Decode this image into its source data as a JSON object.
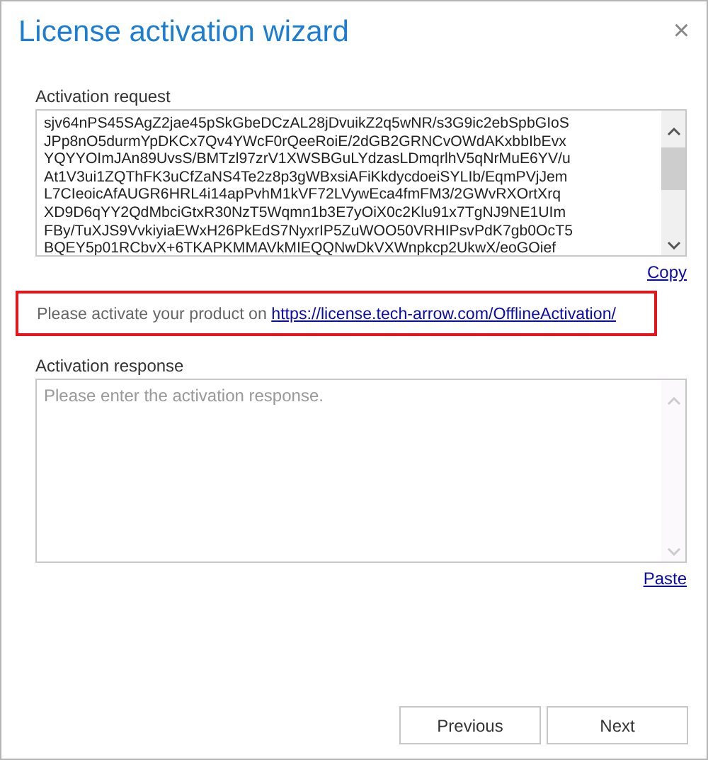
{
  "window": {
    "title": "License activation wizard",
    "close": "×"
  },
  "activation_request": {
    "label": "Activation request",
    "value": "sjv64nPS45SAgZ2jae45pSkGbeDCzAL28jDvuikZ2q5wNR/s3G9ic2ebSpbGIoS\nJPp8nO5durmYpDKCx7Qv4YWcF0rQeeRoiE/2dGB2GRNCvOWdAKxbbIbEvx\nYQYYOImJAn89UvsS/BMTzl97zrV1XWSBGuLYdzasLDmqrlhV5qNrMuE6YV/u\nAt1V3ui1ZQThFK3uCfZaNS4Te2z8p3gWBxsiAFiKkdycdoeiSYLIb/EqmPVjJem\nL7CIeoicAfAUGR6HRL4i14apPvhM1kVF72LVywEca4fmFM3/2GWvRXOrtXrq\nXD9D6qYY2QdMbciGtxR30NzT5Wqmn1b3E7yOiX0c2Klu91x7TgNJ9NE1UIm\nFBy/TuXJS9VvkiyiaEWxH26PkEdS7NyxrIP5ZuWOO50VRHIPsvPdK7gb0OcT5\nBQEY5p01RCbvX+6TKAPKMMAVkMIEQQNwDkVXWnpkcp2UkwX/eoGOief",
    "link": "Copy"
  },
  "notice": {
    "text": "Please activate your product on ",
    "link": "https://license.tech-arrow.com/OfflineActivation/"
  },
  "activation_response": {
    "label": "Activation response",
    "placeholder": "Please enter the activation response.",
    "link": "Paste"
  },
  "buttons": [
    {
      "label": "Previous"
    },
    {
      "label": "Next"
    }
  ]
}
